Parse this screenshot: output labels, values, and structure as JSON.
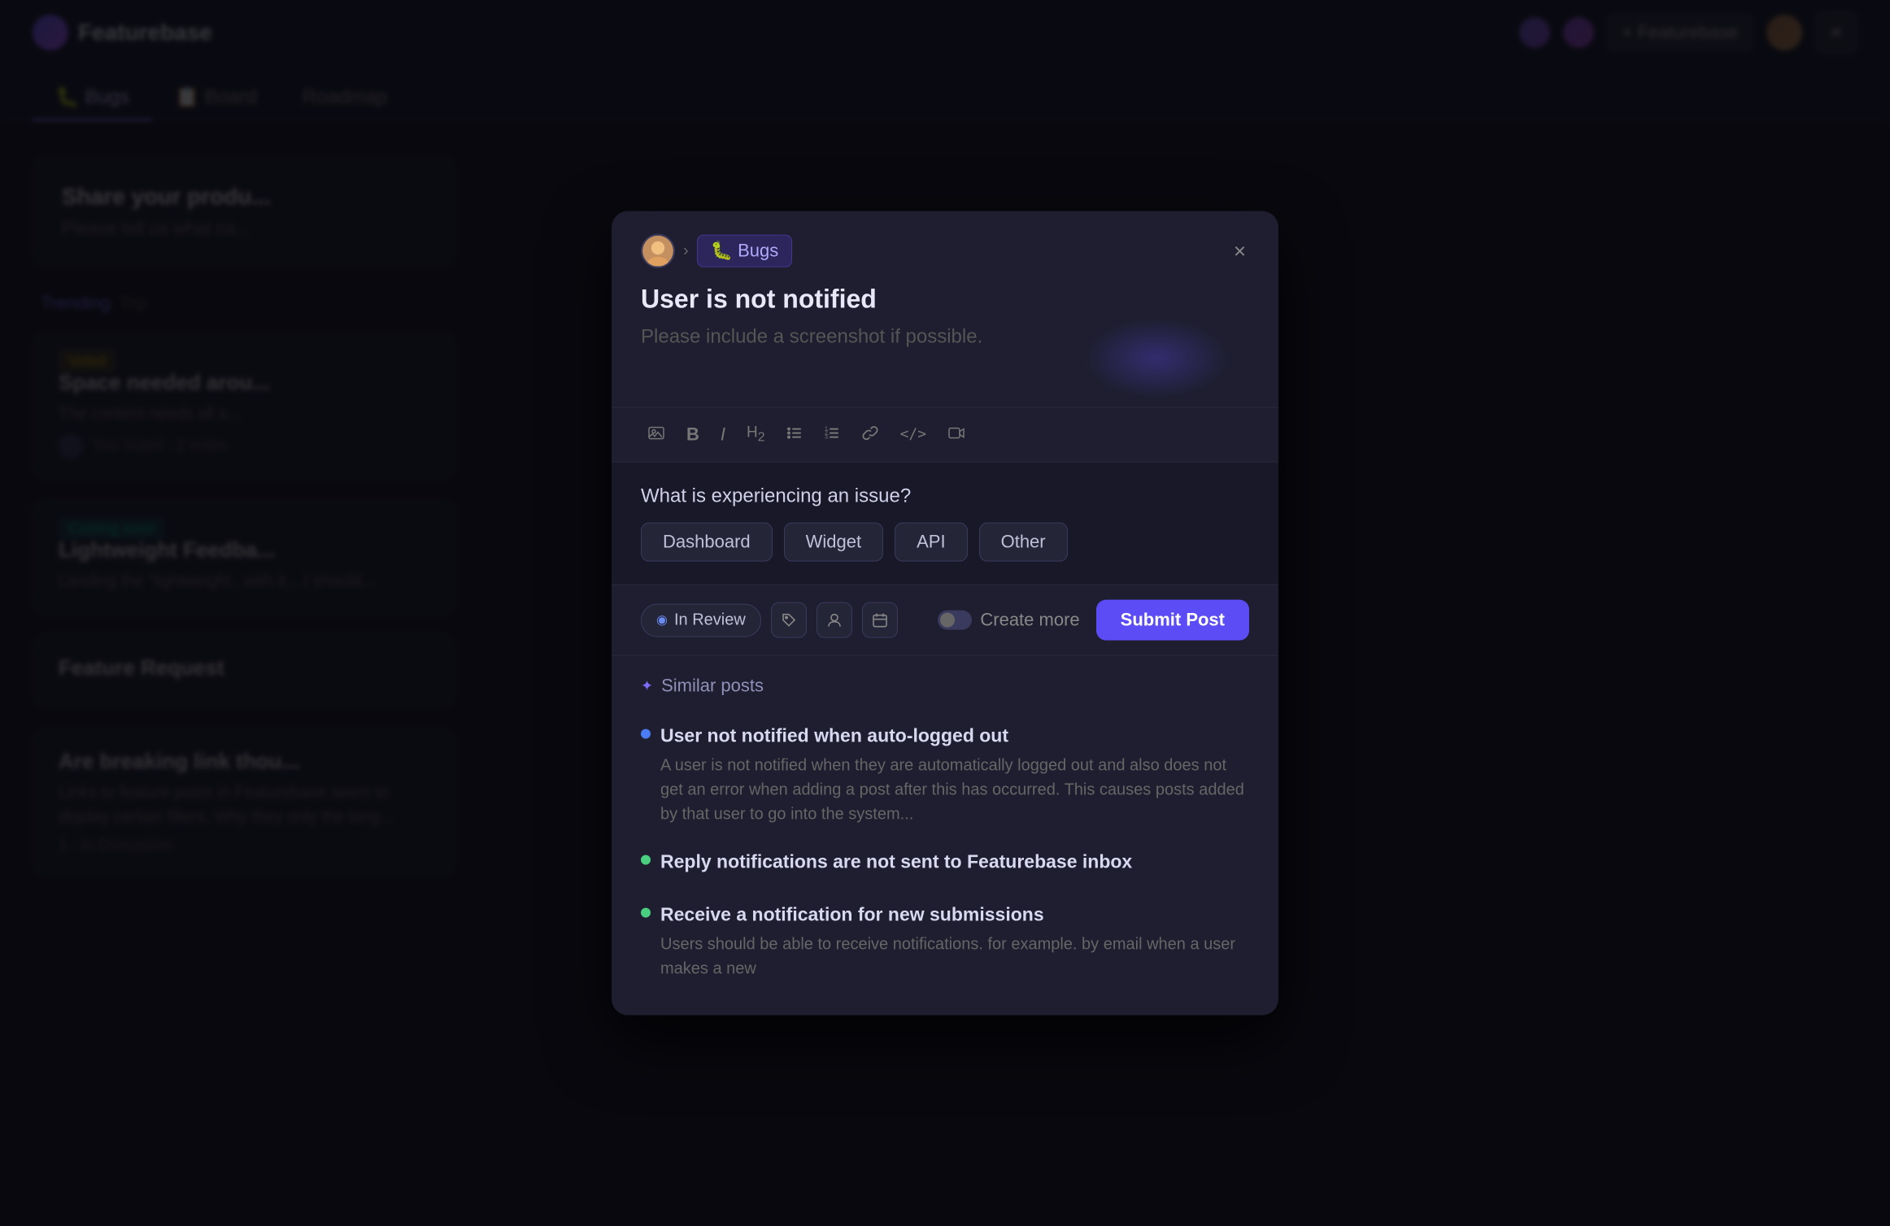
{
  "app": {
    "name": "Featurebase",
    "logo_color": "#7c6cf6"
  },
  "header": {
    "close_label": "×"
  },
  "tabs": [
    {
      "label": "🐛 Bugs",
      "active": true
    },
    {
      "label": "📋 Board",
      "active": false
    },
    {
      "label": "Roadmap",
      "active": false
    }
  ],
  "background": {
    "share_title": "Share your produ...",
    "share_desc": "Please tell us what ca...",
    "trending_label": "Trending",
    "top_label": "Top",
    "items": [
      {
        "badge": "Voted",
        "title": "Space needed arou...",
        "desc": "The content needs all s...",
        "meta": "You Voted · 2 votes"
      },
      {
        "badge": "Coming soon",
        "title": "Lightweight Feedba...",
        "desc": "Landing the 'lightweight...\nwith it...  I should...",
        "meta": ""
      },
      {
        "badge": "",
        "title": "Feature Request",
        "desc": "",
        "meta": ""
      },
      {
        "title": "Are breaking link thou...",
        "desc": "Links to feature posts in Featurebase seem to display certain filters. Why they only the long...",
        "meta": "1 · In Discussion"
      }
    ]
  },
  "modal": {
    "breadcrumb_chevron": "›",
    "tag_emoji": "🐛",
    "tag_label": "Bugs",
    "close_icon": "×",
    "title": "User is not notified",
    "body_placeholder": "Please include a screenshot if possible.",
    "toolbar": {
      "image_icon": "🖼",
      "bold_icon": "B",
      "italic_icon": "I",
      "heading_icon": "H₂",
      "bullet_list_icon": "≡",
      "ordered_list_icon": "≣",
      "link_icon": "🔗",
      "code_icon": "</>",
      "video_icon": "▶"
    },
    "issue_section": {
      "question": "What is experiencing an issue?",
      "options": [
        "Dashboard",
        "Widget",
        "API",
        "Other"
      ]
    },
    "footer": {
      "status_label": "In Review",
      "status_icon": "◉",
      "tag_icon": "🏷",
      "person_icon": "👤",
      "calendar_icon": "📅",
      "create_more_label": "Create more",
      "submit_label": "Submit Post"
    },
    "similar_posts": {
      "section_label": "Similar posts",
      "spark_icon": "✦",
      "items": [
        {
          "dot_color": "blue",
          "title": "User not notified when auto-logged out",
          "desc": "A user is not notified when they are automatically logged out and also does not get an error when adding a post after this has occurred. This causes posts added by that user to go into the system..."
        },
        {
          "dot_color": "green",
          "title": "Reply notifications are not sent to Featurebase inbox",
          "desc": ""
        },
        {
          "dot_color": "green",
          "title": "Receive a notification for new submissions",
          "desc": "Users should be able to receive notifications. for example. by email when a user makes a new"
        }
      ]
    }
  }
}
